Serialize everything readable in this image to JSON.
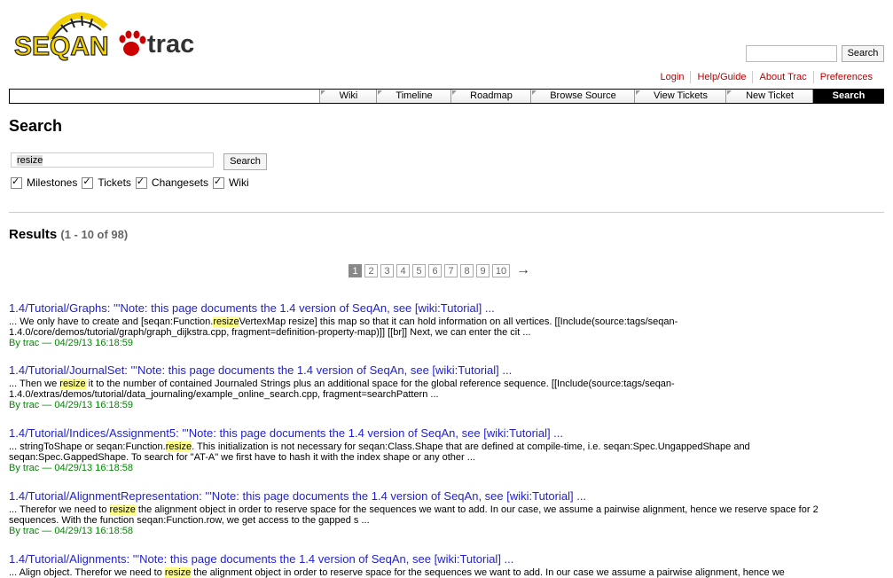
{
  "logo": {
    "seqan_text": "SEQAN",
    "trac_text": "trac"
  },
  "header_search": {
    "value": "",
    "button": "Search"
  },
  "metanav": [
    "Login",
    "Help/Guide",
    "About Trac",
    "Preferences"
  ],
  "mainnav": [
    "Wiki",
    "Timeline",
    "Roadmap",
    "Browse Source",
    "View Tickets",
    "New Ticket",
    "Search"
  ],
  "page": {
    "title": "Search",
    "query": "resize",
    "search_button": "Search",
    "filters": [
      "Milestones",
      "Tickets",
      "Changesets",
      "Wiki"
    ],
    "results_label": "Results",
    "results_count": "(1 - 10 of 98)"
  },
  "pager": {
    "pages": [
      "1",
      "2",
      "3",
      "4",
      "5",
      "6",
      "7",
      "8",
      "9",
      "10"
    ],
    "current": "1",
    "next": "→"
  },
  "results": [
    {
      "title": "1.4/Tutorial/Graphs: '''Note: this page documents the 1.4 version of SeqAn, see [wiki:Tutorial] ...",
      "ex_before": "... We only have to create and [seqan:Function.",
      "ex_hl": "resize",
      "ex_after": "VertexMap resize] this map so that it can hold information on all vertices. [[Include(source:tags/seqan-1.4.0/core/demos/tutorial/graph/graph_dijkstra.cpp, fragment=definition-property-map)]] [[br]] Next, we can enter the cit ...",
      "by": "By trac — 04/29/13 16:18:59"
    },
    {
      "title": "1.4/Tutorial/JournalSet: '''Note: this page documents the 1.4 version of SeqAn, see [wiki:Tutorial] ...",
      "ex_before": "... Then we ",
      "ex_hl": "resize",
      "ex_after": " it to the number of contained Journaled Strings plus an additional space for the global reference sequence. [[Include(source:tags/seqan-1.4.0/extras/demos/tutorial/data_journaling/example_online_search.cpp, fragment=searchPattern ...",
      "by": "By trac — 04/29/13 16:18:59"
    },
    {
      "title": "1.4/Tutorial/Indices/Assignment5: '''Note: this page documents the 1.4 version of SeqAn, see [wiki:Tutorial] ...",
      "ex_before": "... stringToShape or seqan:Function.",
      "ex_hl": "resize",
      "ex_after": ". This initialization is not necessary for seqan:Class.Shape that are defined at compile-time, i.e. seqan:Spec.UngappedShape and seqan:Spec.GappedShape. To search for \"AT-A\" we first have to hash it with the index shape or any other ...",
      "by": "By trac — 04/29/13 16:18:58"
    },
    {
      "title": "1.4/Tutorial/AlignmentRepresentation: '''Note: this page documents the 1.4 version of SeqAn, see [wiki:Tutorial] ...",
      "ex_before": "... Therefor we need to ",
      "ex_hl": "resize",
      "ex_after": " the alignment object in order to reserve space for the sequences we want to add. In our case, we assume a pairwise alignment, hence we reserve space for 2 sequences. With the function seqan:Function.row, we get access to the gapped s ...",
      "by": "By trac — 04/29/13 16:18:58"
    },
    {
      "title": "1.4/Tutorial/Alignments: '''Note: this page documents the 1.4 version of SeqAn, see [wiki:Tutorial] ...",
      "ex_before": "... Align object. Therefor we need to ",
      "ex_hl": "resize",
      "ex_after": " the alignment object in order to reserve space for the sequences we want to add. In our case we assume a pairwise alignment, hence we",
      "by": ""
    }
  ]
}
